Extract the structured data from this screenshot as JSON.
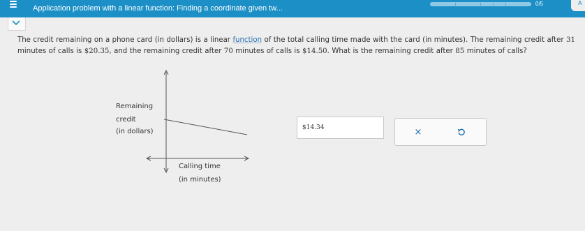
{
  "header": {
    "title": "Application problem with a linear function: Finding a coordinate given tw...",
    "progress_label": "0/5",
    "right_tab_label": "A",
    "progress_fraction": 0
  },
  "question": {
    "p1": "The credit remaining on a phone card (in dollars) is a linear ",
    "link": "function",
    "p2": " of the total calling time made with the card (in minutes). The remaining credit after ",
    "n1": "31",
    "p3": "minutes of calls is ",
    "n2": "$20.35",
    "p4": ", and the remaining credit after ",
    "n3": "70",
    "p5": " minutes of calls is ",
    "n4": "$14.50",
    "p6": ". What is the remaining credit after ",
    "n5": "85",
    "p7": " minutes of calls?"
  },
  "graph": {
    "y_label_1": "Remaining",
    "y_label_2": "credit",
    "y_label_3": "(in dollars)",
    "x_label_1": "Calling time",
    "x_label_2": "(in minutes)"
  },
  "answer": {
    "value": "$14.34"
  },
  "actions": {
    "clear_symbol": "×",
    "undo_icon": "undo-icon"
  },
  "colors": {
    "topbar": "#1b8fc6",
    "action_blue": "#1b6fae"
  }
}
